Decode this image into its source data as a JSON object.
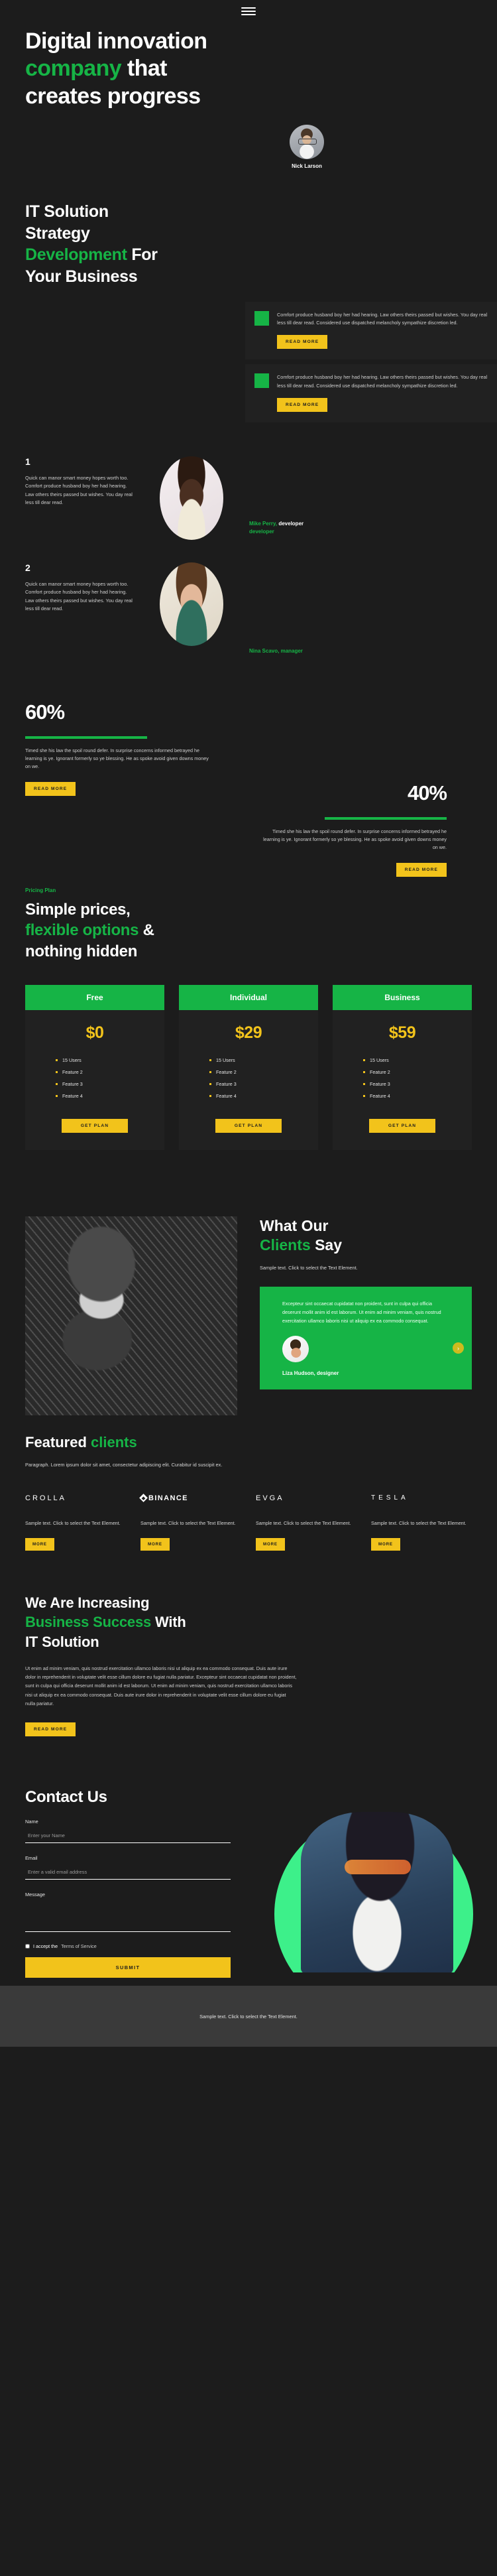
{
  "nav": {
    "menu_icon": "hamburger-menu-icon"
  },
  "hero": {
    "title_line1": "Digital innovation",
    "title_accent": "company",
    "title_line2_rest": " that",
    "title_line3": "creates progress",
    "person_name": "Nick Larson"
  },
  "it_solution": {
    "heading_line1": "IT Solution",
    "heading_line2": "Strategy",
    "heading_accent": "Development",
    "heading_line3_rest": " For",
    "heading_line4": "Your Business",
    "cards": [
      {
        "text": "Comfort produce husband boy her had hearing. Law others theirs passed but wishes. You day real less till dear read. Considered use dispatched melancholy sympathize discretion led.",
        "button": "READ MORE"
      },
      {
        "text": "Comfort produce husband boy her had hearing. Law others theirs passed but wishes. You day real less till dear read. Considered use dispatched melancholy sympathize discretion led.",
        "button": "READ MORE"
      }
    ]
  },
  "team": {
    "members": [
      {
        "number": "1",
        "text": "Quick can manor smart money hopes worth too. Comfort produce husband boy her had hearing. Law others theirs passed but wishes. You day real less till dear read.",
        "name_accent": "Mike Perry,",
        "role": " developer",
        "subrole": "developer"
      },
      {
        "number": "2",
        "text": "Quick can manor smart money hopes worth too. Comfort produce husband boy her had hearing. Law others theirs passed but wishes. You day real less till dear read.",
        "name_accent": "Nina Scavo, manager",
        "role": "",
        "subrole": ""
      }
    ]
  },
  "stats": {
    "items": [
      {
        "value": "60%",
        "text": "Timed she his law the spoil round defer. In surprise concerns informed betrayed he learning is ye. Ignorant formerly so ye blessing. He as spoke avoid given downs money on we.",
        "button": "READ MORE"
      },
      {
        "value": "40%",
        "text": "Timed she his law the spoil round defer. In surprise concerns informed betrayed he learning is ye. Ignorant formerly so ye blessing. He as spoke avoid given downs money on we.",
        "button": "READ MORE"
      }
    ]
  },
  "pricing": {
    "eyebrow": "Pricing Plan",
    "heading_line1": "Simple prices,",
    "heading_accent": "flexible options",
    "heading_line2_rest": " &",
    "heading_line3": "nothing hidden",
    "plans": [
      {
        "name": "Free",
        "price": "$0",
        "features": [
          "15 Users",
          "Feature 2",
          "Feature 3",
          "Feature 4"
        ],
        "button": "GET PLAN"
      },
      {
        "name": "Individual",
        "price": "$29",
        "features": [
          "15 Users",
          "Feature 2",
          "Feature 3",
          "Feature 4"
        ],
        "button": "GET PLAN"
      },
      {
        "name": "Business",
        "price": "$59",
        "features": [
          "15 Users",
          "Feature 2",
          "Feature 3",
          "Feature 4"
        ],
        "button": "GET PLAN"
      }
    ]
  },
  "testimonials": {
    "heading_line1": "What Our",
    "heading_accent": "Clients",
    "heading_line2_rest": " Say",
    "subtitle": "Sample text. Click to select the Text Element.",
    "quote": "Excepteur sint occaecat cupidatat non proident, sunt in culpa qui officia deserunt mollit anim id est laborum. Ut enim ad minim veniam, quis nostrud exercitation ullamco laboris nisi ut aliquip ex ea commodo consequat.",
    "author": "Liza Hudson, designer",
    "next_icon": "chevron-right-icon"
  },
  "clients": {
    "heading": "Featured ",
    "heading_accent": "clients",
    "subtitle": "Paragraph. Lorem ipsum dolor sit amet, consectetur adipiscing elit. Curabitur id suscipit ex.",
    "items": [
      {
        "logo": "CROLLA",
        "text": "Sample text. Click to select the Text Element.",
        "button": "MORE"
      },
      {
        "logo": "BINANCE",
        "text": "Sample text. Click to select the Text Element.",
        "button": "MORE"
      },
      {
        "logo": "EVGA",
        "text": "Sample text. Click to select the Text Element.",
        "button": "MORE"
      },
      {
        "logo": "TESLA",
        "text": "Sample text. Click to select the Text Element.",
        "button": "MORE"
      }
    ]
  },
  "business": {
    "heading_line1": "We Are Increasing",
    "heading_accent": "Business Success",
    "heading_line2_rest": " With",
    "heading_line3": "IT Solution",
    "paragraph": "Ut enim ad minim veniam, quis nostrud exercitation ullamco laboris nisi ut aliquip ex ea commodo consequat. Duis aute irure dolor in reprehenderit in voluptate velit esse cillum dolore eu fugiat nulla pariatur. Excepteur sint occaecat cupidatat non proident, sunt in culpa qui officia deserunt mollit anim id est laborum. Ut enim ad minim veniam, quis nostrud exercitation ullamco laboris nisi ut aliquip ex ea commodo consequat. Duis aute irure dolor in reprehenderit in voluptate velit esse cillum dolore eu fugiat nulla pariatur.",
    "button": "READ MORE"
  },
  "contact": {
    "heading": "Contact Us",
    "name_label": "Name",
    "name_placeholder": "Enter your Name",
    "name_value": "",
    "email_label": "Email",
    "email_placeholder": "Enter a valid email address",
    "email_value": "",
    "message_label": "Message",
    "message_placeholder": "",
    "message_value": "",
    "tos_prefix": "I accept the",
    "tos_link": "Terms of Service",
    "submit": "SUBMIT"
  },
  "footer": {
    "text": "Sample text. Click to select the Text Element."
  },
  "colors": {
    "background": "#1c1c1c",
    "surface": "#212121",
    "green": "#16b446",
    "yellow": "#f2c31b",
    "footer": "#3a3a3a"
  }
}
